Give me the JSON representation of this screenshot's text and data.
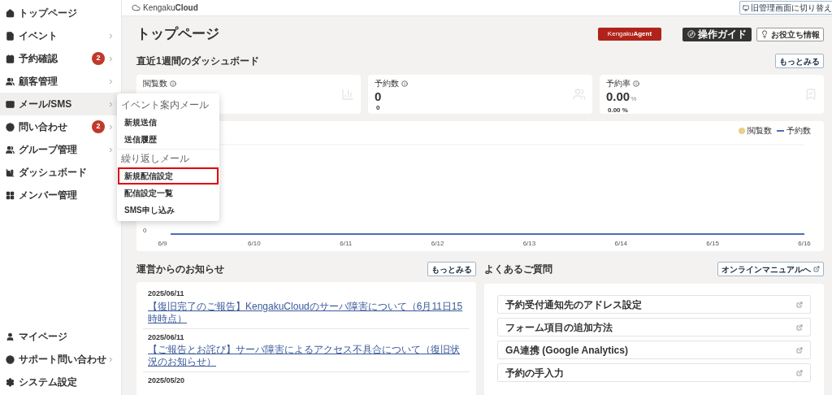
{
  "sidebar": {
    "items": [
      {
        "label": "トップページ",
        "submenu": false,
        "selected": false
      },
      {
        "label": "イベント",
        "submenu": true,
        "selected": false
      },
      {
        "label": "予約確認",
        "submenu": true,
        "badge": "2",
        "selected": false
      },
      {
        "label": "顧客管理",
        "submenu": true,
        "selected": false
      },
      {
        "label": "メール/SMS",
        "submenu": true,
        "selected": true
      },
      {
        "label": "問い合わせ",
        "submenu": true,
        "badge": "2",
        "selected": false
      },
      {
        "label": "グループ管理",
        "submenu": true,
        "selected": false
      },
      {
        "label": "ダッシュボード",
        "submenu": false,
        "selected": false
      },
      {
        "label": "メンバー管理",
        "submenu": false,
        "selected": false
      }
    ],
    "bottom_items": [
      {
        "label": "マイページ",
        "submenu": false
      },
      {
        "label": "サポート問い合わせ",
        "submenu": true
      },
      {
        "label": "システム設定",
        "submenu": false
      }
    ]
  },
  "submenu": [
    {
      "kind": "group",
      "label": "イベント案内メール"
    },
    {
      "kind": "item",
      "label": "新規送信",
      "highlighted": false
    },
    {
      "kind": "item",
      "label": "送信履歴",
      "highlighted": false
    },
    {
      "kind": "group",
      "label": "繰り返しメール"
    },
    {
      "kind": "item",
      "label": "新規配信設定",
      "highlighted": true
    },
    {
      "kind": "item",
      "label": "配信設定一覧",
      "highlighted": false
    },
    {
      "kind": "item",
      "label": "SMS申し込み",
      "highlighted": false
    }
  ],
  "header": {
    "logo": "Kengaku",
    "logo_bold": "Cloud",
    "switch_button": "旧管理画面に切り替え"
  },
  "page": {
    "title": "トップページ",
    "agent_button": {
      "text": "Kengaku",
      "bold": "Agent"
    },
    "guide_button": "操作ガイド",
    "tips_button": "お役立ち情報"
  },
  "dashboard": {
    "title": "直近1週間のダッシュボード",
    "more_button": "もっとみる",
    "stats": [
      {
        "label": "閲覧数"
      },
      {
        "label": "予約数",
        "value": "0",
        "sub": "0"
      },
      {
        "label": "予約率",
        "value": "0.00",
        "unit": "%",
        "sub": "0.00 %"
      }
    ],
    "chart": {
      "legend": [
        {
          "name": "閲覧数",
          "color": "#e8cf8a",
          "kind": "dot"
        },
        {
          "name": "予約数",
          "color": "#4a6fb5",
          "kind": "line"
        }
      ],
      "y_label": "0",
      "x_labels": [
        "6/9",
        "6/10",
        "6/11",
        "6/12",
        "6/13",
        "6/14",
        "6/15",
        "6/16"
      ]
    }
  },
  "news": {
    "title": "運営からのお知らせ",
    "more_button": "もっとみる",
    "items": [
      {
        "date": "2025/06/11",
        "title": "【復旧完了のご報告】KengakuCloudのサーバ障害について（6月11日15時時点）"
      },
      {
        "date": "2025/06/11",
        "title": "【ご報告とお詫び】サーバ障害によるアクセス不具合について（復旧状況のお知らせ）"
      },
      {
        "date": "2025/05/20"
      }
    ]
  },
  "faq": {
    "title": "よくあるご質問",
    "manual_button": "オンラインマニュアルへ",
    "items": [
      "予約受付通知先のアドレス設定",
      "フォーム項目の追加方法",
      "GA連携 (Google Analytics)",
      "予約の手入力"
    ]
  }
}
